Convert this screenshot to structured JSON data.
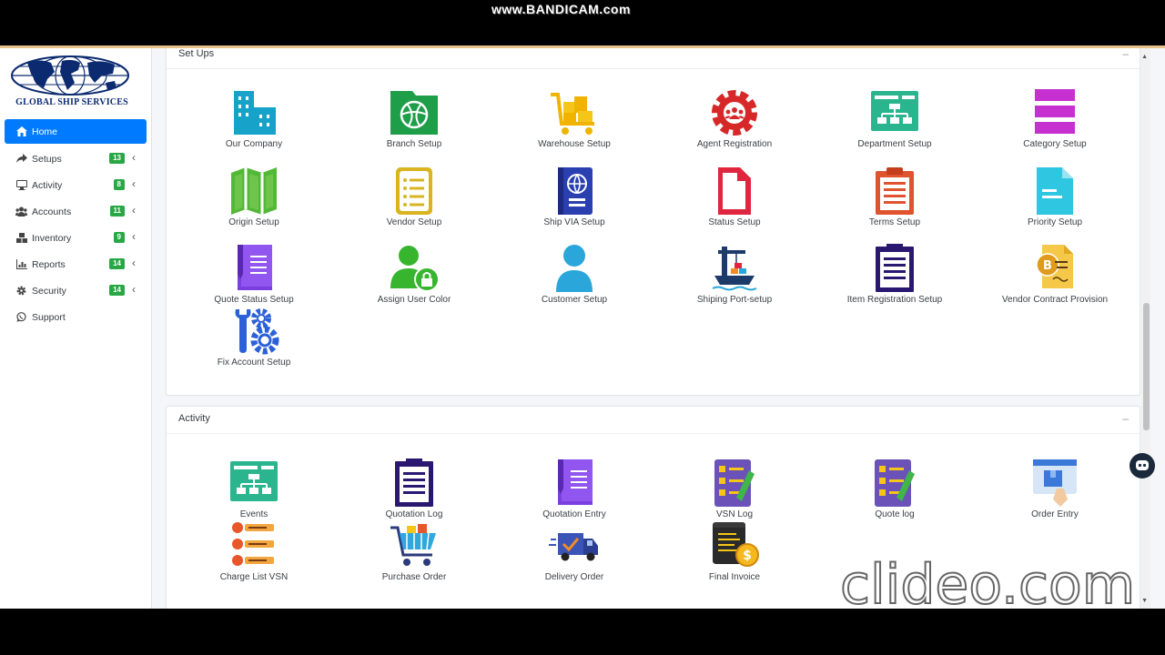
{
  "watermarks": {
    "top": "www.BANDICAM.com",
    "bottom": "clideo.com"
  },
  "brand": {
    "name": "GLOBAL SHIP SERVICES"
  },
  "sidebar": {
    "items": [
      {
        "label": "Home",
        "icon": "home-icon",
        "active": true
      },
      {
        "label": "Setups",
        "icon": "share-icon",
        "badge": "13"
      },
      {
        "label": "Activity",
        "icon": "desktop-icon",
        "badge": "8"
      },
      {
        "label": "Accounts",
        "icon": "users-icon",
        "badge": "11"
      },
      {
        "label": "Inventory",
        "icon": "boxes-icon",
        "badge": "9"
      },
      {
        "label": "Reports",
        "icon": "chart-icon",
        "badge": "14"
      },
      {
        "label": "Security",
        "icon": "gear-icon",
        "badge": "14"
      },
      {
        "label": "Support",
        "icon": "whatsapp-icon"
      }
    ]
  },
  "setups": {
    "title": "Set Ups",
    "tiles": [
      {
        "label": "Our Company",
        "icon": "building-icon"
      },
      {
        "label": "Branch Setup",
        "icon": "folder-ball-icon"
      },
      {
        "label": "Warehouse Setup",
        "icon": "cart-boxes-icon"
      },
      {
        "label": "Agent Registration",
        "icon": "gear-users-icon"
      },
      {
        "label": "Department Setup",
        "icon": "org-chart-icon"
      },
      {
        "label": "Category Setup",
        "icon": "bars-icon"
      },
      {
        "label": "Origin Setup",
        "icon": "map-icon"
      },
      {
        "label": "Vendor Setup",
        "icon": "list-doc-icon"
      },
      {
        "label": "Ship VIA Setup",
        "icon": "passport-icon"
      },
      {
        "label": "Status Setup",
        "icon": "file-icon"
      },
      {
        "label": "Terms Setup",
        "icon": "clipboard-icon"
      },
      {
        "label": "Priority Setup",
        "icon": "doc-icon"
      },
      {
        "label": "Quote Status Setup",
        "icon": "document-pen-icon"
      },
      {
        "label": "Assign User Color",
        "icon": "user-lock-icon"
      },
      {
        "label": "Customer Setup",
        "icon": "user-icon"
      },
      {
        "label": "Shiping Port-setup",
        "icon": "port-crane-icon"
      },
      {
        "label": "Item Registration Setup",
        "icon": "clipboard-list-icon"
      },
      {
        "label": "Vendor Contract Provision",
        "icon": "bitcoin-contract-icon"
      },
      {
        "label": "Fix Account Setup",
        "icon": "tools-gear-icon"
      }
    ]
  },
  "activity": {
    "title": "Activity",
    "tiles": [
      {
        "label": "Events",
        "icon": "org-chart-icon"
      },
      {
        "label": "Quotation Log",
        "icon": "clipboard-list-icon"
      },
      {
        "label": "Quotation Entry",
        "icon": "document-pen-icon"
      },
      {
        "label": "VSN Log",
        "icon": "checklist-icon"
      },
      {
        "label": "Quote log",
        "icon": "checklist-icon"
      },
      {
        "label": "Order Entry",
        "icon": "order-box-icon"
      },
      {
        "label": "Charge List VSN",
        "icon": "charge-list-icon"
      },
      {
        "label": "Purchase Order",
        "icon": "shopping-cart-icon"
      },
      {
        "label": "Delivery Order",
        "icon": "truck-icon"
      },
      {
        "label": "Final Invoice",
        "icon": "invoice-coin-icon"
      }
    ]
  },
  "colors": {
    "accent": "#007bff",
    "badge": "#28a745"
  }
}
